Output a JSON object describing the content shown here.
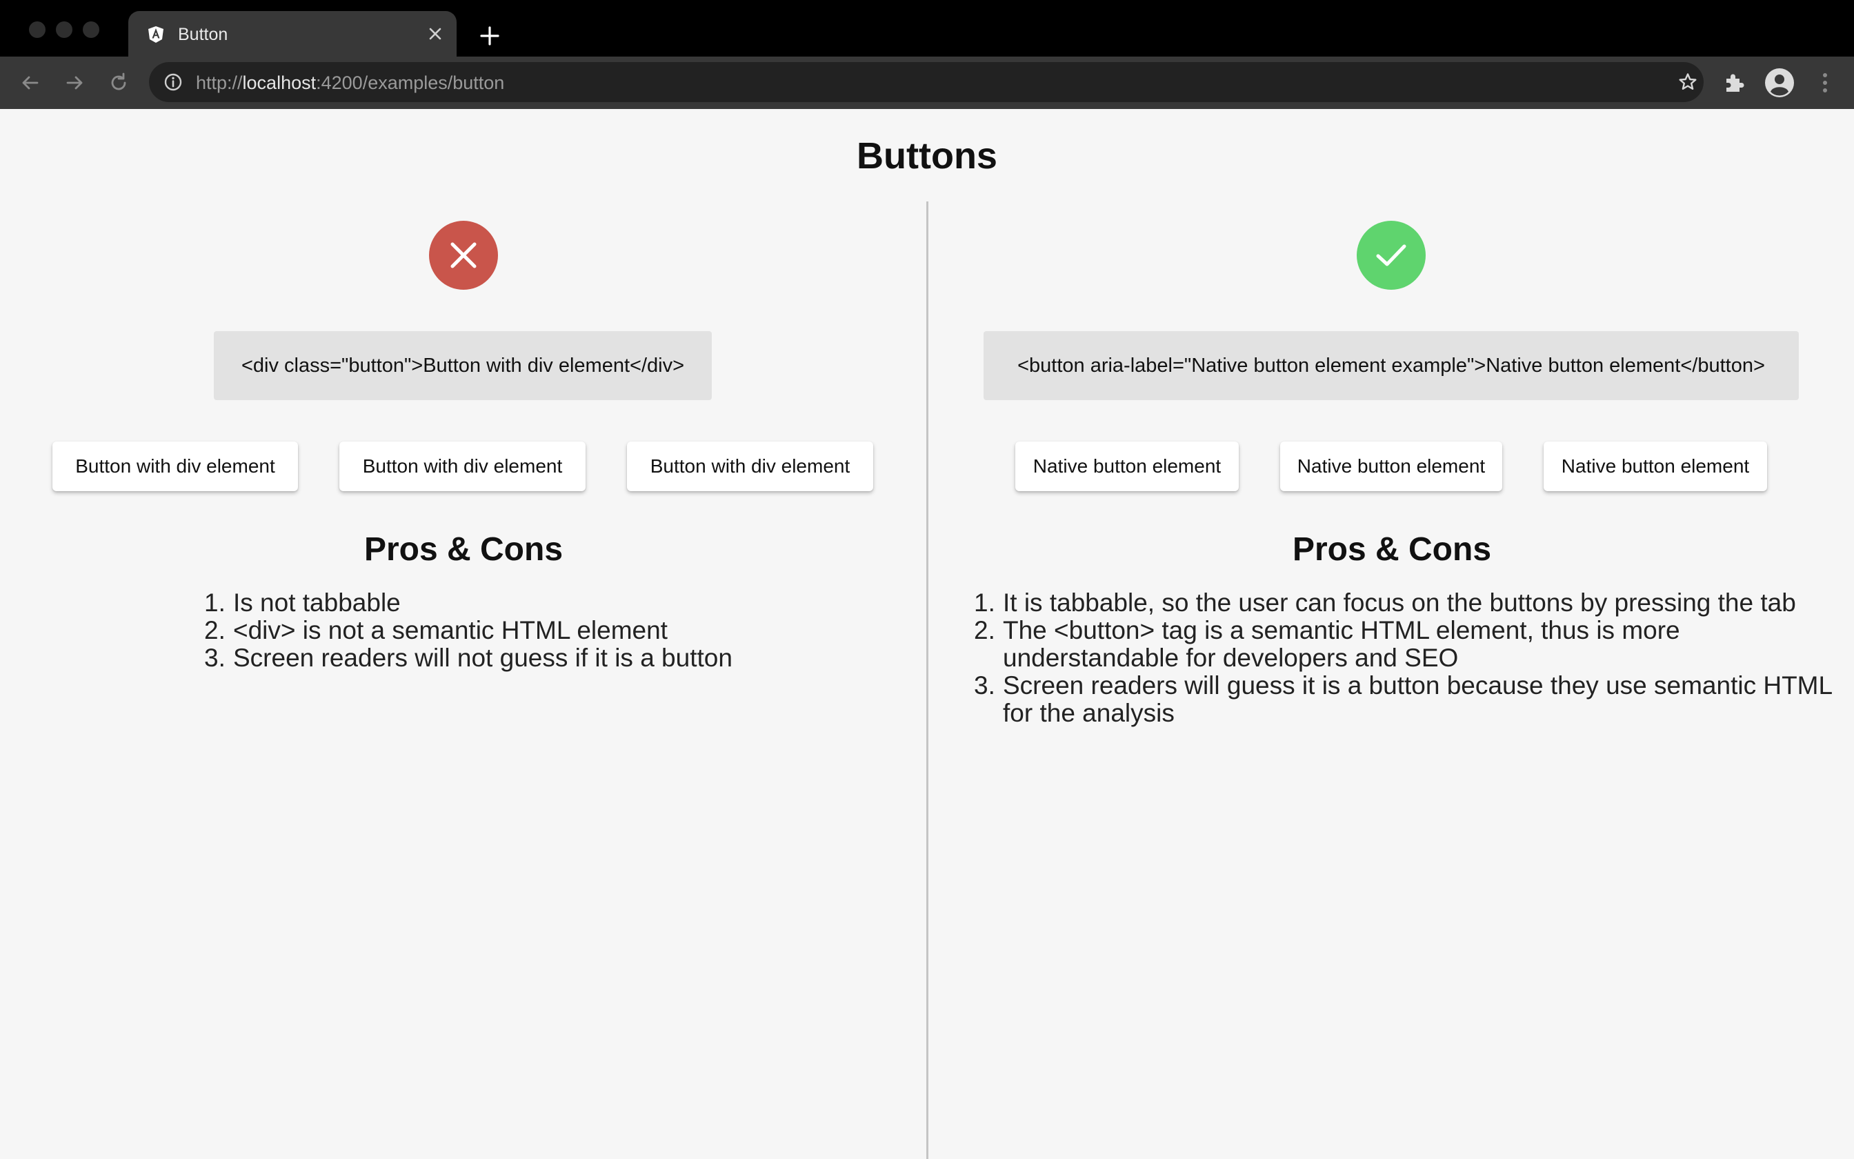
{
  "browser": {
    "tab_title": "Button",
    "url_scheme": "http://",
    "url_host": "localhost",
    "url_path": ":4200/examples/button",
    "theme": {
      "titlebar": "#000000",
      "toolbar": "#383838",
      "omnibox": "#222222"
    }
  },
  "page": {
    "title": "Buttons",
    "bad": {
      "status_icon": "close-icon",
      "status_color": "#c9554b",
      "code": "<div class=\"button\">Button with div element</div>",
      "buttons": [
        "Button with div element",
        "Button with div element",
        "Button with div element"
      ],
      "pros_cons_heading": "Pros & Cons",
      "items": [
        {
          "num": "1.",
          "text": "Is not tabbable"
        },
        {
          "num": "2.",
          "text": "<div> is not a semantic HTML element"
        },
        {
          "num": "3.",
          "text": "Screen readers will not guess if it is a button"
        }
      ]
    },
    "good": {
      "status_icon": "check-icon",
      "status_color": "#5fd46e",
      "code": "<button aria-label=\"Native button element example\">Native button element</button>",
      "buttons": [
        "Native button element",
        "Native button element",
        "Native button element"
      ],
      "pros_cons_heading": "Pros & Cons",
      "items": [
        {
          "num": "1.",
          "text": "It is tabbable, so the user can focus on the buttons by pressing the tab"
        },
        {
          "num": "2.",
          "text": "The <button> tag is a semantic HTML element, thus is more understandable for developers and SEO"
        },
        {
          "num": "3.",
          "text": "Screen readers will guess it is a button because they use semantic HTML for the analysis"
        }
      ]
    }
  }
}
